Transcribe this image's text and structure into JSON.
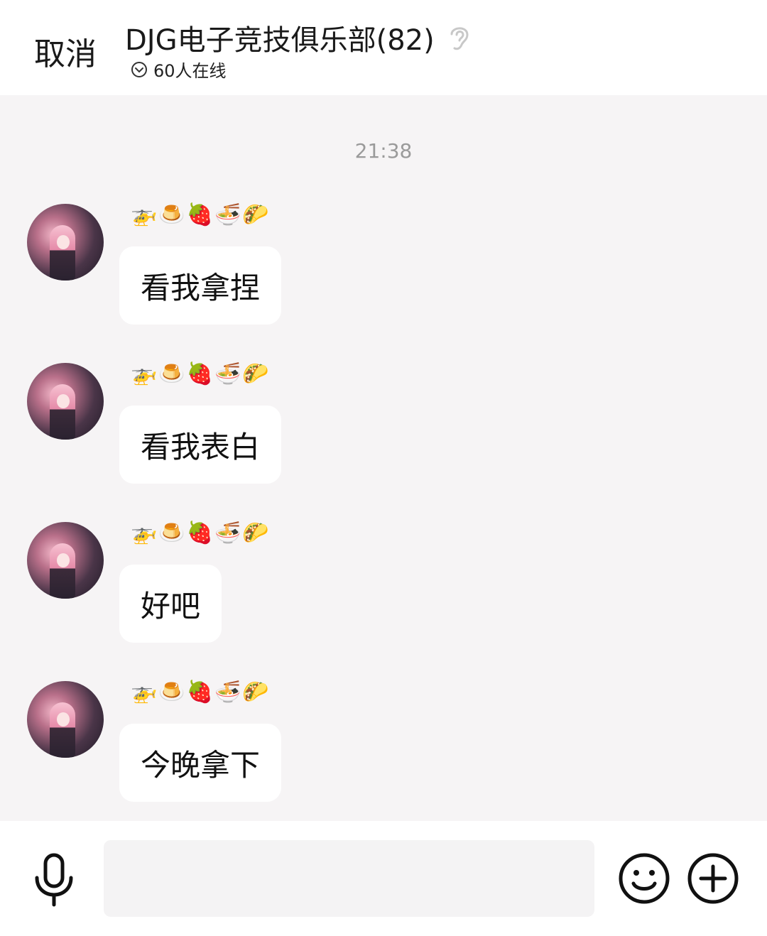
{
  "header": {
    "cancel_label": "取消",
    "title": "DJG电子竞技俱乐部(82)",
    "ear_icon": "ear-icon",
    "online_icon": "chevron-circle-down-icon",
    "online_text": "60人在线"
  },
  "chat": {
    "timestamp": "21:38",
    "messages": [
      {
        "sender": "🚁🍮🍓🍜🌮",
        "text": "看我拿捏"
      },
      {
        "sender": "🚁🍮🍓🍜🌮",
        "text": "看我表白"
      },
      {
        "sender": "🚁🍮🍓🍜🌮",
        "text": "好吧"
      },
      {
        "sender": "🚁🍮🍓🍜🌮",
        "text": "今晚拿下"
      }
    ]
  },
  "input_bar": {
    "mic_icon": "microphone-icon",
    "input_value": "",
    "emoji_icon": "smiley-icon",
    "plus_icon": "plus-circle-icon"
  }
}
